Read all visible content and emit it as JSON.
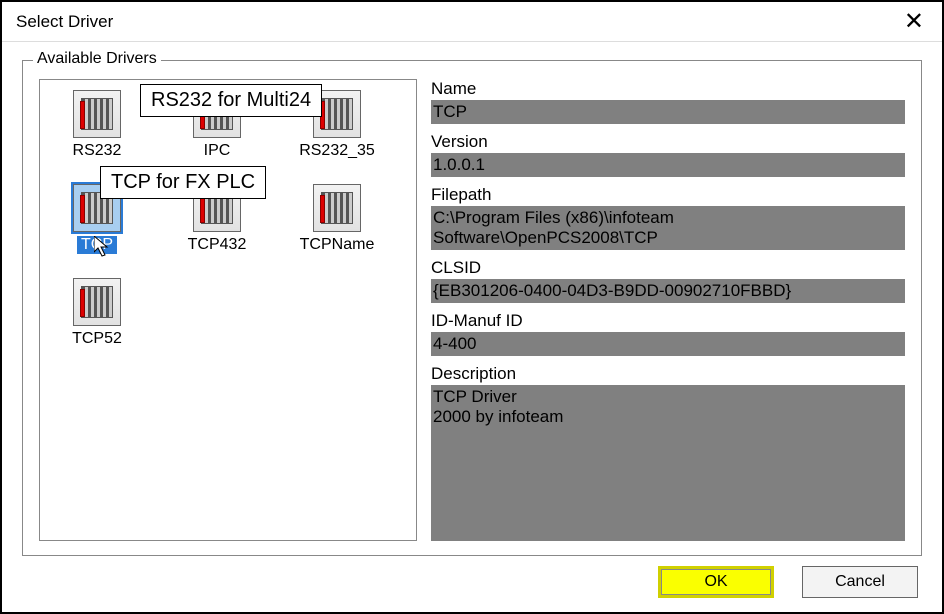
{
  "window": {
    "title": "Select Driver"
  },
  "group": {
    "label": "Available Drivers"
  },
  "tooltips": {
    "rs232": "RS232 for Multi24",
    "tcp": "TCP for FX PLC"
  },
  "drivers": {
    "row1": [
      {
        "label": "RS232"
      },
      {
        "label": "IPC"
      },
      {
        "label": "RS232_35"
      }
    ],
    "row2": [
      {
        "label": "TCP"
      },
      {
        "label": "TCP432"
      },
      {
        "label": "TCPName"
      }
    ],
    "row3": [
      {
        "label": "TCP52"
      }
    ]
  },
  "details": {
    "name_label": "Name",
    "name_value": "TCP",
    "version_label": "Version",
    "version_value": "1.0.0.1",
    "filepath_label": "Filepath",
    "filepath_value": "C:\\Program Files (x86)\\infoteam Software\\OpenPCS2008\\TCP",
    "clsid_label": "CLSID",
    "clsid_value": "{EB301206-0400-04D3-B9DD-00902710FBBD}",
    "idmanuf_label": "ID-Manuf ID",
    "idmanuf_value": "4-400",
    "description_label": "Description",
    "description_value": "TCP Driver\n2000 by infoteam"
  },
  "buttons": {
    "ok": "OK",
    "cancel": "Cancel"
  }
}
